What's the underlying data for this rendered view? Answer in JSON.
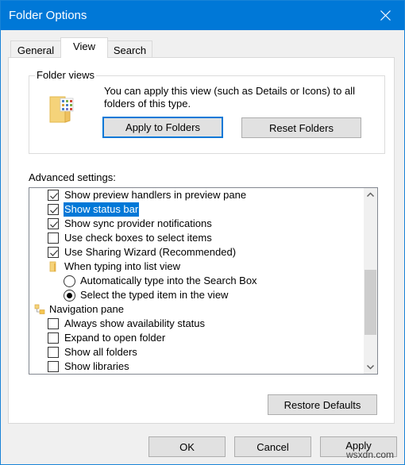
{
  "window": {
    "title": "Folder Options",
    "close_icon": "close-icon"
  },
  "tabs": [
    {
      "label": "General",
      "active": false
    },
    {
      "label": "View",
      "active": true
    },
    {
      "label": "Search",
      "active": false
    }
  ],
  "folder_views": {
    "label": "Folder views",
    "icon": "folder-views-icon",
    "description": "You can apply this view (such as Details or Icons) to all folders of this type.",
    "apply_button": "Apply to Folders",
    "reset_button": "Reset Folders"
  },
  "advanced": {
    "label": "Advanced settings:",
    "items": [
      {
        "type": "checkbox",
        "label": "Show preview handlers in preview pane",
        "checked": true,
        "selected": false
      },
      {
        "type": "checkbox",
        "label": "Show status bar",
        "checked": true,
        "selected": true
      },
      {
        "type": "checkbox",
        "label": "Show sync provider notifications",
        "checked": true,
        "selected": false
      },
      {
        "type": "checkbox",
        "label": "Use check boxes to select items",
        "checked": false,
        "selected": false
      },
      {
        "type": "checkbox",
        "label": "Use Sharing Wizard (Recommended)",
        "checked": true,
        "selected": false
      },
      {
        "type": "folder",
        "label": "When typing into list view",
        "icon": "folder-icon"
      },
      {
        "type": "radio",
        "label": "Automatically type into the Search Box",
        "checked": false
      },
      {
        "type": "radio",
        "label": "Select the typed item in the view",
        "checked": true
      },
      {
        "type": "group",
        "label": "Navigation pane",
        "icon": "navigation-pane-icon"
      },
      {
        "type": "checkbox",
        "label": "Always show availability status",
        "checked": false,
        "selected": false
      },
      {
        "type": "checkbox",
        "label": "Expand to open folder",
        "checked": false,
        "selected": false
      },
      {
        "type": "checkbox",
        "label": "Show all folders",
        "checked": false,
        "selected": false
      },
      {
        "type": "checkbox",
        "label": "Show libraries",
        "checked": false,
        "selected": false
      }
    ],
    "scroll_position_fraction": 0.62,
    "restore_button": "Restore Defaults"
  },
  "footer": {
    "ok": "OK",
    "cancel": "Cancel",
    "apply": "Apply",
    "watermark": "wsxdn.com"
  }
}
